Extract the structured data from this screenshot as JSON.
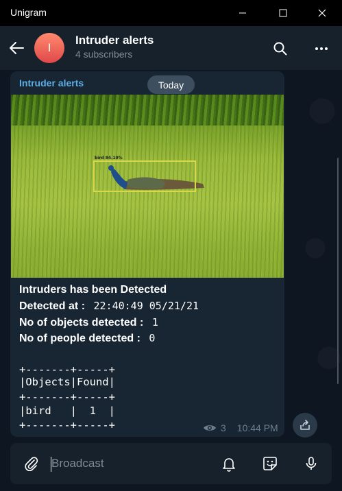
{
  "window": {
    "title": "Unigram",
    "controls": [
      "minimize-icon",
      "maximize-icon",
      "close-icon"
    ]
  },
  "header": {
    "avatar_letter": "I",
    "title": "Intruder alerts",
    "subtitle": "4 subscribers",
    "icons": [
      "back-arrow-icon",
      "search-icon",
      "more-dots-icon"
    ]
  },
  "chat": {
    "date_pill": "Today",
    "message": {
      "author": "Intruder alerts",
      "photo": {
        "detection_label": "bird 84.10%"
      },
      "line1": "Intruders has been Detected",
      "line2_label": "Detected at :",
      "line2_value": "22:40:49 05/21/21",
      "line3_label": "No of objects detected :",
      "line3_value": "1",
      "line4_label": "No of people detected :",
      "line4_value": "0",
      "table": [
        "+-------+-----+",
        "|Objects|Found|",
        "+-------+-----+",
        "|bird   |  1  |",
        "+-------+-----+"
      ],
      "views": "3",
      "time": "10:44 PM"
    }
  },
  "composer": {
    "placeholder": "Broadcast",
    "icons": [
      "attach-icon",
      "bell-icon",
      "sticker-icon",
      "microphone-icon"
    ]
  },
  "colors": {
    "background": "#0e1621",
    "header": "#17212b",
    "bubble": "#182533",
    "accent": "#5eaee6",
    "avatar": "#e0484a"
  }
}
